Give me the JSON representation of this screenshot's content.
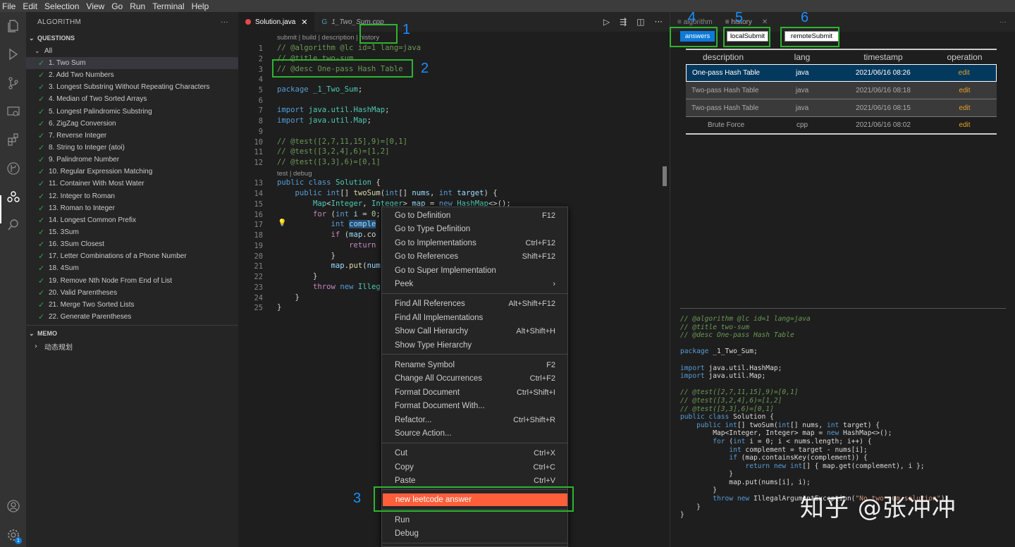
{
  "menu": [
    "File",
    "Edit",
    "Selection",
    "View",
    "Go",
    "Run",
    "Terminal",
    "Help"
  ],
  "sidebar": {
    "title": "ALGORITHM",
    "more": "···",
    "questions_label": "QUESTIONS",
    "all_label": "All",
    "questions": [
      "1. Two Sum",
      "2. Add Two Numbers",
      "3. Longest Substring Without Repeating Characters",
      "4. Median of Two Sorted Arrays",
      "5. Longest Palindromic Substring",
      "6. ZigZag Conversion",
      "7. Reverse Integer",
      "8. String to Integer (atoi)",
      "9. Palindrome Number",
      "10. Regular Expression Matching",
      "11. Container With Most Water",
      "12. Integer to Roman",
      "13. Roman to Integer",
      "14. Longest Common Prefix",
      "15. 3Sum",
      "16. 3Sum Closest",
      "17. Letter Combinations of a Phone Number",
      "18. 4Sum",
      "19. Remove Nth Node From End of List",
      "20. Valid Parentheses",
      "21. Merge Two Sorted Lists",
      "22. Generate Parentheses"
    ],
    "memo_label": "MEMO",
    "memo_child": "动态规划"
  },
  "editor": {
    "tabs": [
      {
        "label": "Solution.java"
      },
      {
        "label": "1_Two_Sum.cpp"
      }
    ],
    "codelens_top": "submit | build | description | history",
    "codelens_mid": "test | debug",
    "line_numbers": [
      "1",
      "2",
      "3",
      "4",
      "5",
      "6",
      "7",
      "8",
      "9",
      "10",
      "11",
      "12",
      "13",
      "14",
      "15",
      "16",
      "17",
      "18",
      "19",
      "20",
      "21",
      "22",
      "23",
      "24",
      "25"
    ]
  },
  "context_menu": {
    "items": [
      {
        "label": "Go to Definition",
        "key": "F12"
      },
      {
        "label": "Go to Type Definition",
        "key": ""
      },
      {
        "label": "Go to Implementations",
        "key": "Ctrl+F12"
      },
      {
        "label": "Go to References",
        "key": "Shift+F12"
      },
      {
        "label": "Go to Super Implementation",
        "key": ""
      },
      {
        "label": "Peek",
        "key": "›"
      },
      {
        "label": "Find All References",
        "key": "Alt+Shift+F12"
      },
      {
        "label": "Find All Implementations",
        "key": ""
      },
      {
        "label": "Show Call Hierarchy",
        "key": "Alt+Shift+H"
      },
      {
        "label": "Show Type Hierarchy",
        "key": ""
      },
      {
        "label": "Rename Symbol",
        "key": "F2"
      },
      {
        "label": "Change All Occurrences",
        "key": "Ctrl+F2"
      },
      {
        "label": "Format Document",
        "key": "Ctrl+Shift+I"
      },
      {
        "label": "Format Document With...",
        "key": ""
      },
      {
        "label": "Refactor...",
        "key": "Ctrl+Shift+R"
      },
      {
        "label": "Source Action...",
        "key": ""
      },
      {
        "label": "Cut",
        "key": "Ctrl+X"
      },
      {
        "label": "Copy",
        "key": "Ctrl+C"
      },
      {
        "label": "Paste",
        "key": "Ctrl+V"
      },
      {
        "label": "new leetcode answer",
        "key": ""
      },
      {
        "label": "Run",
        "key": ""
      },
      {
        "label": "Debug",
        "key": ""
      }
    ]
  },
  "right_panel": {
    "tabs": [
      "algorithm",
      "history"
    ],
    "buttons": {
      "answers": "answers",
      "localSubmit": "localSubmit",
      "remoteSubmit": "remoteSubmit"
    },
    "table": {
      "headers": [
        "description",
        "lang",
        "timestamp",
        "operation"
      ],
      "rows": [
        [
          "One-pass Hash Table",
          "java",
          "2021/06/16 08:26",
          "edit"
        ],
        [
          "Two-pass Hash Table",
          "java",
          "2021/06/16 08:18",
          "edit"
        ],
        [
          "Two-pass Hash Table",
          "java",
          "2021/06/16 08:15",
          "edit"
        ],
        [
          "Brute Force",
          "cpp",
          "2021/06/16 08:02",
          "edit"
        ]
      ]
    }
  },
  "annotations": [
    "1",
    "2",
    "3",
    "4",
    "5",
    "6"
  ],
  "watermark": "知乎 @张冲冲",
  "badge": "1"
}
